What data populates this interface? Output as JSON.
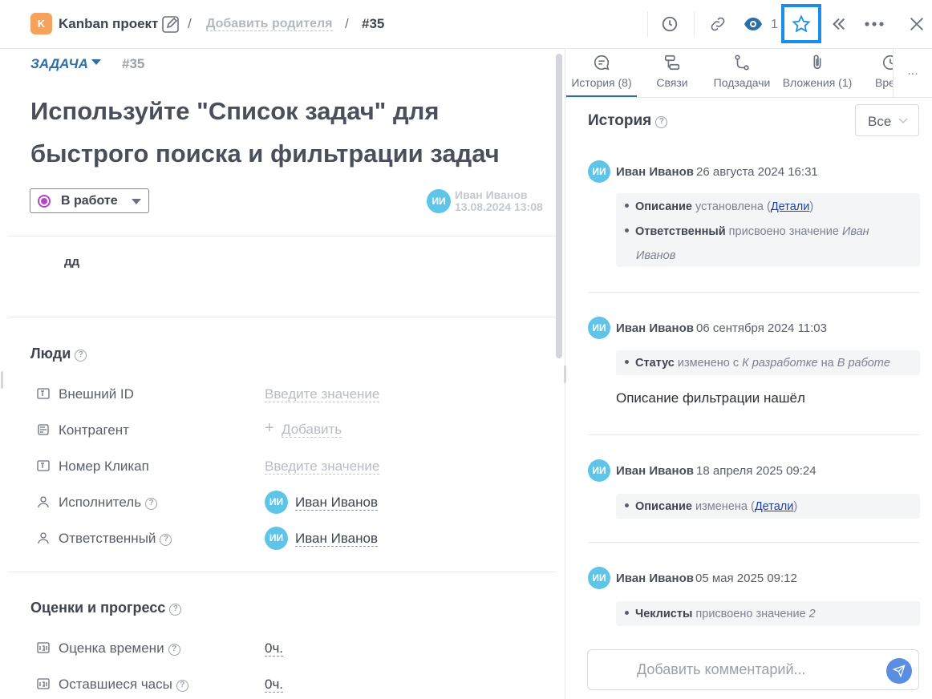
{
  "header": {
    "project_badge": "K",
    "project_name": "Kanban проект",
    "sep1": "/",
    "add_parent": "Добавить родителя",
    "sep2": "/",
    "task_number": "#35",
    "watch_count": "1"
  },
  "task": {
    "type_label": "ЗАДАЧА",
    "number": "#35",
    "title_line1": "Используйте \"Список задач\" для",
    "title_line2": "быстрого поиска и фильтрации задач",
    "status": "В работе",
    "author_initials": "ИИ",
    "author_name": "Иван Иванов",
    "author_date": "13.08.2024 13:08",
    "description": "дд"
  },
  "people": {
    "title": "Люди",
    "help": "?",
    "fields": [
      {
        "label": "Внешний ID",
        "value": "Введите значение"
      },
      {
        "label": "Контрагент",
        "value": "Добавить"
      },
      {
        "label": "Номер Кликап",
        "value": "Введите значение"
      },
      {
        "label": "Исполнитель",
        "initials": "ИИ",
        "value": "Иван Иванов"
      },
      {
        "label": "Ответственный",
        "initials": "ИИ",
        "value": "Иван Иванов"
      }
    ]
  },
  "estimates": {
    "title": "Оценки и прогресс",
    "fields": [
      {
        "label": "Оценка времени",
        "value": "0ч."
      },
      {
        "label": "Оставшиеся часы",
        "value": "0ч."
      }
    ]
  },
  "tabs": [
    {
      "label": "История (8)",
      "icon": "history-chat-icon"
    },
    {
      "label": "Связи",
      "icon": "links-icon"
    },
    {
      "label": "Подзадачи",
      "icon": "subtasks-icon"
    },
    {
      "label": "Вложения (1)",
      "icon": "paperclip-icon"
    },
    {
      "label": "Вре",
      "icon": "clock-icon"
    }
  ],
  "tabs_more": "...",
  "history": {
    "title": "История",
    "filter": "Все",
    "entries": [
      {
        "initials": "ИИ",
        "author": "Иван Иванов",
        "date": "26 августа 2024 16:31",
        "l1_bold": "Описание",
        "l1_text": " установлена (",
        "l1_link": "Детали",
        "l1_end": ")",
        "l2_bold": "Ответственный",
        "l2_text": " присвоено значение ",
        "l2_val_a": "Иван",
        "l2_val_b": "Иванов"
      },
      {
        "initials": "ИИ",
        "author": "Иван Иванов",
        "date": "06 сентября 2024 11:03",
        "l1_bold": "Статус",
        "l1_text": " изменено с ",
        "l1_from": "К разработке",
        "l1_mid": " на ",
        "l1_to": "В работе",
        "comment": "Описание фильтрации нашёл"
      },
      {
        "initials": "ИИ",
        "author": "Иван Иванов",
        "date": "18 апреля 2025 09:24",
        "l1_bold": "Описание",
        "l1_text": " изменена (",
        "l1_link": "Детали",
        "l1_end": ")"
      },
      {
        "initials": "ИИ",
        "author": "Иван Иванов",
        "date": "05 мая 2025 09:12",
        "l1_bold": "Чеклисты",
        "l1_text": " присвоено значение ",
        "l1_val": "2"
      }
    ]
  },
  "comment": {
    "placeholder": "Добавить комментарий..."
  },
  "colors": {
    "accent": "#2c6fa8",
    "status": "#b545c8",
    "avatar": "#5fc5e8",
    "project": "#f5a25d",
    "highlight": "#1b8fe8"
  }
}
